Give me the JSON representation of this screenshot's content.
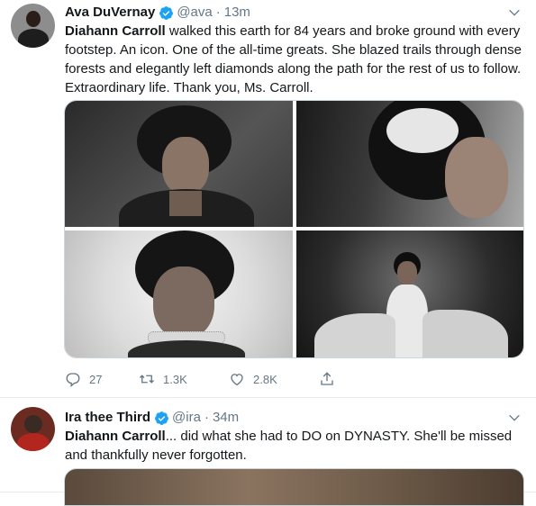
{
  "tweets": [
    {
      "display_name": "Ava DuVernay",
      "handle": "@ava",
      "separator": "·",
      "time": "13m",
      "text_bold": "Diahann Carroll",
      "text_rest": " walked this earth for 84 years and broke ground with every footstep. An icon. One of the all-time greats. She blazed trails through dense forests and elegantly left diamonds along the path for the rest of us to follow. Extraordinary life. Thank you, Ms. Carroll.",
      "verified": true,
      "actions": {
        "replies": "27",
        "retweets": "1.3K",
        "likes": "2.8K"
      },
      "media": {
        "photos": [
          {
            "subject": "portrait-smiling"
          },
          {
            "subject": "portrait-headpiece"
          },
          {
            "subject": "portrait-bouffant"
          },
          {
            "subject": "full-length-gown"
          }
        ]
      }
    },
    {
      "display_name": "Ira thee Third",
      "handle": "@ira",
      "separator": "·",
      "time": "34m",
      "text_bold": "Diahann Carroll",
      "text_rest": "... did what she had to DO on DYNASTY. She'll be missed and thankfully never forgotten.",
      "verified": true
    }
  ],
  "colors": {
    "verified_blue": "#1da1f2",
    "secondary_text": "#657786",
    "primary_text": "#14171a",
    "divider": "#e6ecf0"
  },
  "icons": [
    "verified-badge-icon",
    "chevron-down-icon",
    "reply-icon",
    "retweet-icon",
    "like-icon",
    "share-icon"
  ]
}
